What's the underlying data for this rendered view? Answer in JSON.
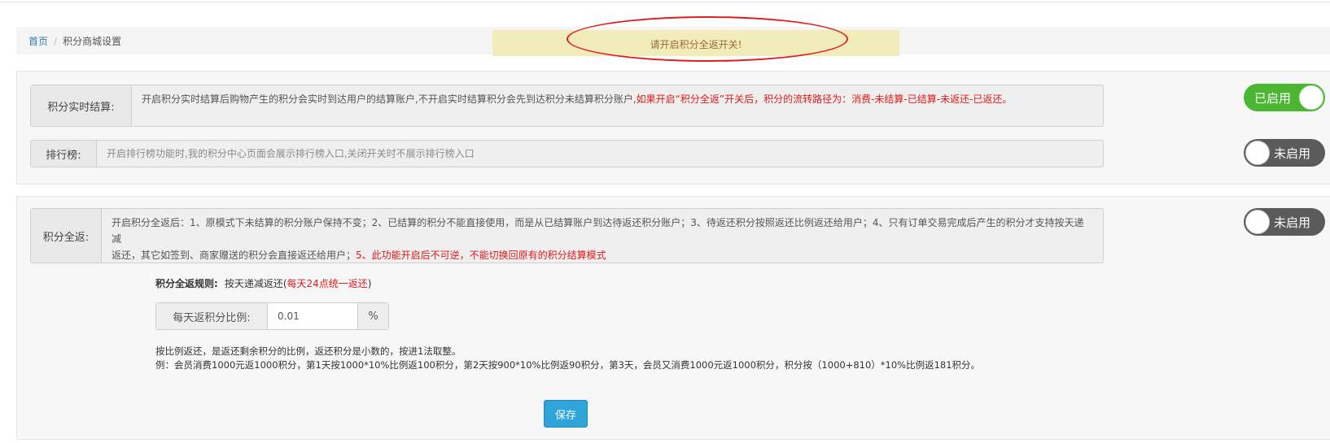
{
  "breadcrumb": {
    "home": "首页",
    "separator": "/",
    "current": "积分商城设置"
  },
  "alert": {
    "message": "请开启积分全返开关!"
  },
  "settings": {
    "realtime": {
      "label": "积分实时结算:",
      "desc_normal": "开启积分实时结算后购物产生的积分会实时到达用户的结算账户,不开启实时结算积分会先到达积分未结算积分账户,",
      "desc_red": "如果开启“积分全返”开关后，积分的流转路径为：消费-未结算-已结算-未返还-已返还。",
      "toggle": {
        "state": "on",
        "text": "已启用"
      }
    },
    "ranking": {
      "label": "排行榜:",
      "desc": "开启排行榜功能时,我的积分中心页面会展示排行榜入口,关闭开关时不展示排行榜入口",
      "toggle": {
        "state": "off",
        "text": "未启用"
      }
    },
    "full_return": {
      "label": "积分全返:",
      "desc_line1": "开启积分全返后：1、原模式下未结算的积分账户保持不变；2、已结算的积分不能直接使用，而是从已结算账户到达待返还积分账户；3、待返还积分按照返还比例返还给用户；4、只有订单交易完成后产生的积分才支持按天递减",
      "desc_line2_normal": "返还，其它如签到、商家赠送的积分会直接返还给用户；",
      "desc_line2_red": "5、此功能开启后不可逆，不能切换回原有的积分结算模式",
      "toggle": {
        "state": "off",
        "text": "未启用"
      }
    }
  },
  "rule": {
    "label": "积分全返规则:",
    "value": "按天递减返还(",
    "value_red": "每天24点统一返还",
    "value_end": ")"
  },
  "ratio": {
    "label": "每天返积分比例:",
    "value": "0.01",
    "unit": "%"
  },
  "notes": {
    "line1": "按比例返还，是返还剩余积分的比例，返还积分是小数的，按进1法取整。",
    "line2": "例：会员消费1000元返1000积分，第1天按1000*10%比例返100积分，第2天按900*10%比例返90积分，第3天，会员又消费1000元返1000积分，积分按（1000+810）*10%比例返181积分。"
  },
  "buttons": {
    "save": "保存"
  },
  "colors": {
    "enabled": "#4cb532",
    "disabled": "#5b5b5b",
    "warning_red": "#e0191b",
    "primary": "#2fa4d8",
    "alert_bg": "#f1ecb9"
  }
}
